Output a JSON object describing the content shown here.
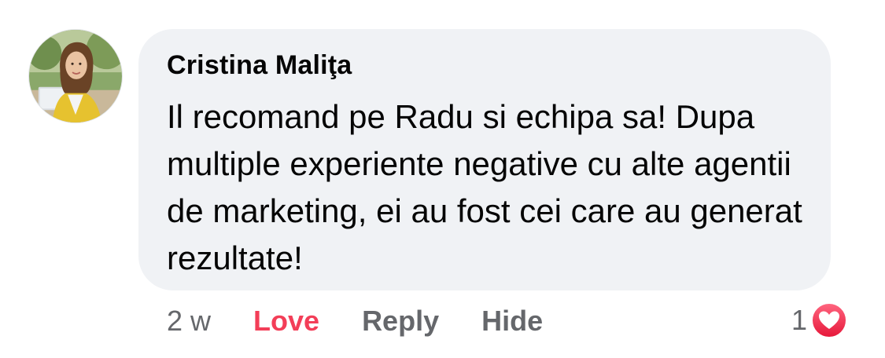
{
  "comment": {
    "author": "Cristina Maliţa",
    "text": "Il recomand pe Radu si echipa sa! Dupa multiple experiente negative cu alte agentii de marketing, ei au fost cei care au generat rezultate!",
    "avatar_icon": "user-avatar-photo"
  },
  "actions": {
    "time": "2 w",
    "love_label": "Love",
    "reply_label": "Reply",
    "hide_label": "Hide"
  },
  "reactions": {
    "count": "1",
    "icon": "heart-reaction-icon"
  },
  "colors": {
    "bubble": "#f0f2f5",
    "love": "#f33e58",
    "muted": "#65676b",
    "text": "#050505"
  }
}
